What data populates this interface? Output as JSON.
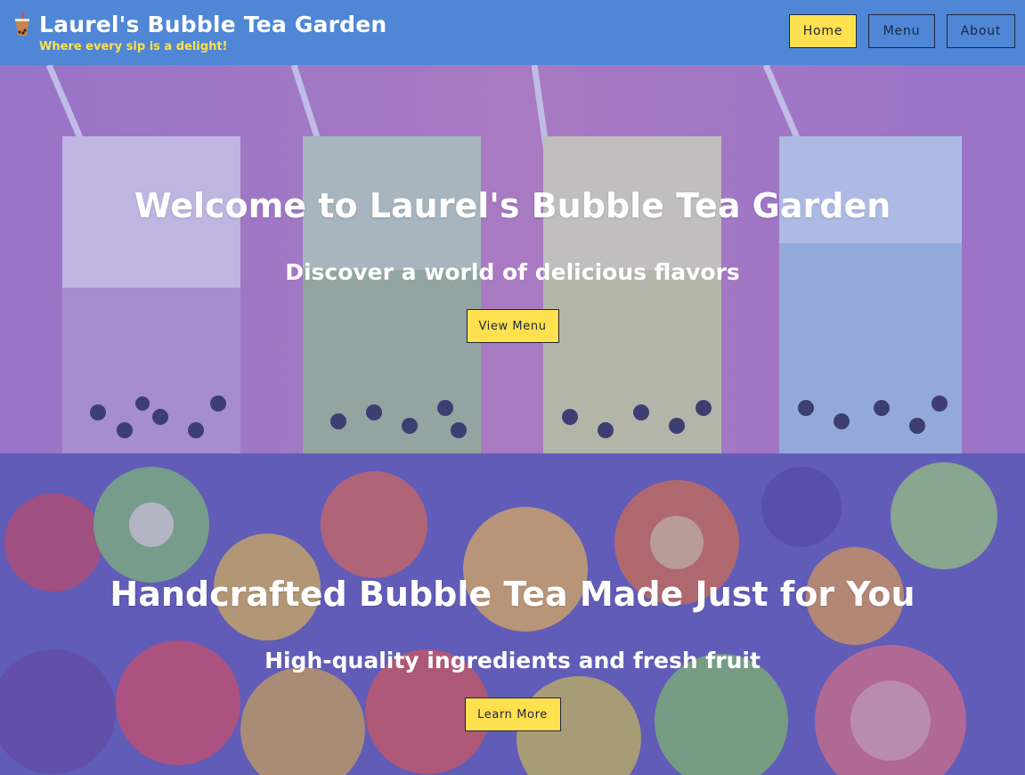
{
  "header": {
    "title": "Laurel's Bubble Tea Garden",
    "tagline": "Where every sip is a delight!",
    "logo_icon": "bubble-tea-cup-icon",
    "nav": [
      {
        "label": "Home",
        "active": true
      },
      {
        "label": "Menu",
        "active": false
      },
      {
        "label": "About",
        "active": false
      }
    ]
  },
  "hero": {
    "title": "Welcome to Laurel's Bubble Tea Garden",
    "subtitle": "Discover a world of delicious flavors",
    "button": "View Menu",
    "image": "bubble-tea-glasses-photo"
  },
  "feature": {
    "title": "Handcrafted Bubble Tea Made Just for You",
    "subtitle": "High-quality ingredients and fresh fruit",
    "button": "Learn More",
    "image": "fresh-fruit-photo"
  },
  "colors": {
    "header_bg": "#4f87d6",
    "accent": "#ffe04e",
    "button_border": "#1d2640",
    "text_light": "#ffffff"
  }
}
